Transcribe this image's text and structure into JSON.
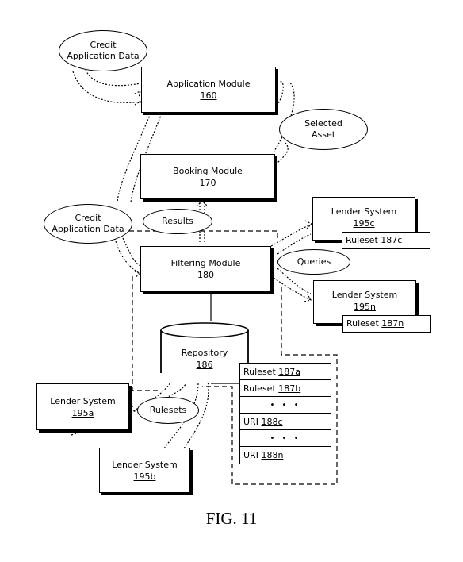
{
  "figure": {
    "caption": "FIG. 11",
    "nodes": {
      "application_module": {
        "label": "Application Module",
        "ref": "160"
      },
      "booking_module": {
        "label": "Booking Module",
        "ref": "170"
      },
      "filtering_module": {
        "label": "Filtering Module",
        "ref": "180"
      },
      "repository": {
        "label": "Repository",
        "ref": "186"
      },
      "lender_195a": {
        "label": "Lender System",
        "ref": "195a"
      },
      "lender_195b": {
        "label": "Lender System",
        "ref": "195b"
      },
      "lender_195c": {
        "label": "Lender System",
        "ref": "195c",
        "ruleset_label": "Ruleset",
        "ruleset_ref": "187c"
      },
      "lender_195n": {
        "label": "Lender System",
        "ref": "195n",
        "ruleset_label": "Ruleset",
        "ruleset_ref": "187n"
      }
    },
    "flows": {
      "credit_app_data_top": {
        "line1": "Credit",
        "line2": "Application Data"
      },
      "credit_app_data_mid": {
        "line1": "Credit",
        "line2": "Application Data"
      },
      "selected_asset": {
        "line1": "Selected",
        "line2": "Asset"
      },
      "results": {
        "line1": "Results"
      },
      "queries": {
        "line1": "Queries"
      },
      "rulesets": {
        "line1": "Rulesets"
      }
    },
    "repository_entries": [
      {
        "label": "Ruleset",
        "ref": "187a"
      },
      {
        "label": "Ruleset",
        "ref": "187b"
      },
      {
        "label": "• • •",
        "ref": ""
      },
      {
        "label": "URI",
        "ref": "188c"
      },
      {
        "label": "• • •",
        "ref": ""
      },
      {
        "label": "URI",
        "ref": "188n"
      }
    ]
  }
}
